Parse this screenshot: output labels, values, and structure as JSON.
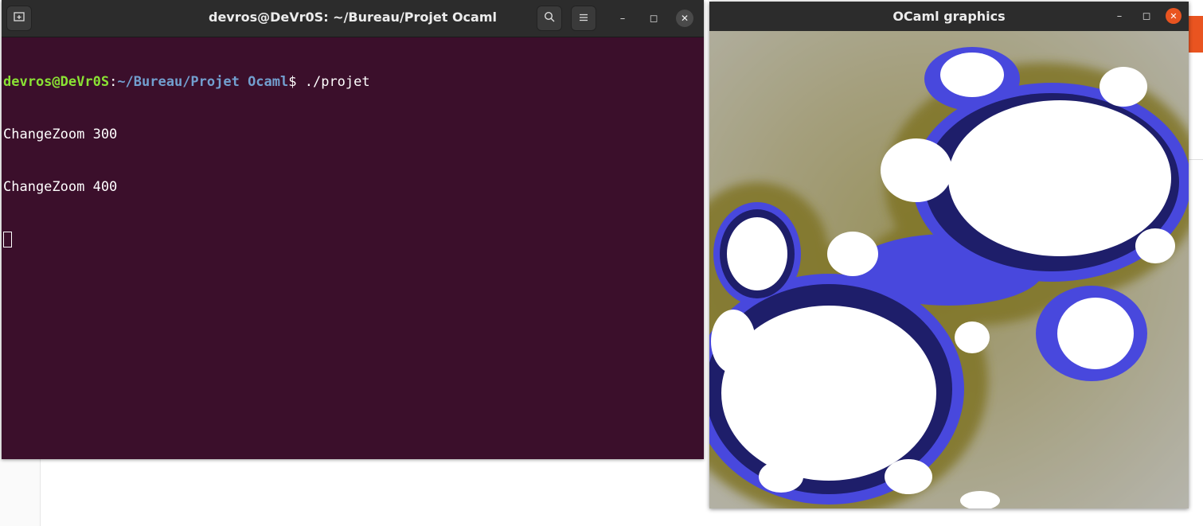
{
  "terminal": {
    "title": "devros@DeVr0S: ~/Bureau/Projet Ocaml",
    "prompt": {
      "user_host": "devros@DeVr0S",
      "colon": ":",
      "path": "~/Bureau/Projet Ocaml",
      "dollar": "$",
      "command": " ./projet"
    },
    "output": [
      "ChangeZoom 300",
      "ChangeZoom 400"
    ],
    "colors": {
      "background": "#3b0f2b",
      "user": "#8ae234",
      "path": "#729fcf"
    }
  },
  "graphics_window": {
    "title": "OCaml graphics",
    "colors": {
      "background": "#b3b3ab",
      "olive": "#7a6f22",
      "blue": "#4646e0",
      "set": "#ffffff"
    }
  },
  "icons": {
    "new_tab": "new-tab-icon",
    "search": "search-icon",
    "menu": "hamburger-menu-icon",
    "minimize": "minimize-icon",
    "maximize": "maximize-icon",
    "close": "close-icon"
  }
}
